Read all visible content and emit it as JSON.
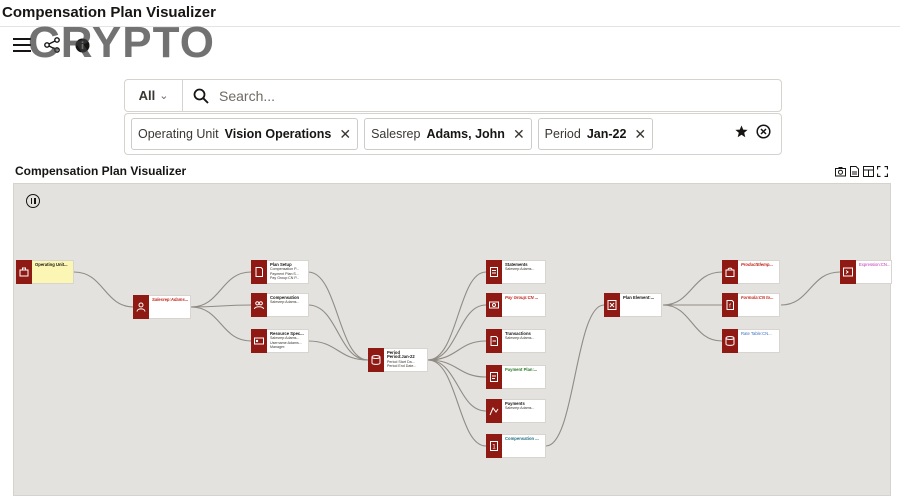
{
  "app": {
    "title": "Compensation Plan Visualizer",
    "watermark": "CRYPTO"
  },
  "toolbar": {
    "icons": [
      "hamburger-menu-icon",
      "share-network-icon",
      "info-icon"
    ]
  },
  "search": {
    "scope": "All",
    "placeholder": "Search..."
  },
  "filters": [
    {
      "label": "Operating Unit",
      "value": "Vision Operations"
    },
    {
      "label": "Salesrep",
      "value": "Adams, John"
    },
    {
      "label": "Period",
      "value": "Jan-22"
    }
  ],
  "section": {
    "title": "Compensation Plan Visualizer"
  },
  "colors": {
    "node_icon": "#8e1a13",
    "canvas": "#e4e2de",
    "root_highlight": "#fbf6b4"
  },
  "nodes": [
    {
      "id": "ou",
      "title": "Operating Unit...",
      "lines": []
    },
    {
      "id": "salesrep",
      "title": "Salesrep:Adams...",
      "lines": []
    },
    {
      "id": "plansetup",
      "title": "Plan Setup",
      "lines": [
        "Compensation P...",
        "Payment Plan:S...",
        "Pay Group:CN P..."
      ]
    },
    {
      "id": "compensation",
      "title": "Compensation",
      "lines": [
        "Salesrep:Adams..."
      ]
    },
    {
      "id": "resource",
      "title": "Resource Spec...",
      "lines": [
        "Salesrep:Adams...",
        "Username:Adams...",
        "Manager:"
      ]
    },
    {
      "id": "period",
      "title": "Period",
      "lines": [
        "Period:Jan-22",
        "Period Start Da...",
        "Period End Date..."
      ]
    },
    {
      "id": "statements",
      "title": "Statements",
      "lines": [
        "Salesrep:Adams..."
      ]
    },
    {
      "id": "paygroup",
      "title": "Pay Group:CN ...",
      "lines": []
    },
    {
      "id": "transactions",
      "title": "Transactions",
      "lines": [
        "Salesrep:Adams..."
      ]
    },
    {
      "id": "paymentplan",
      "title": "Payment Plan:...",
      "lines": []
    },
    {
      "id": "payments",
      "title": "Payments",
      "lines": [
        "Salesrep:Adams..."
      ]
    },
    {
      "id": "compplan",
      "title": "Compensation ...",
      "lines": []
    },
    {
      "id": "planelement",
      "title": "Plan Element:...",
      "lines": []
    },
    {
      "id": "product",
      "title": "ProductElemp...",
      "lines": []
    },
    {
      "id": "formula",
      "title": "Formula:CN to...",
      "lines": []
    },
    {
      "id": "ratetable",
      "title": "Rate Table:CN...",
      "lines": []
    },
    {
      "id": "expression",
      "title": "Expression:CN...",
      "lines": []
    }
  ]
}
